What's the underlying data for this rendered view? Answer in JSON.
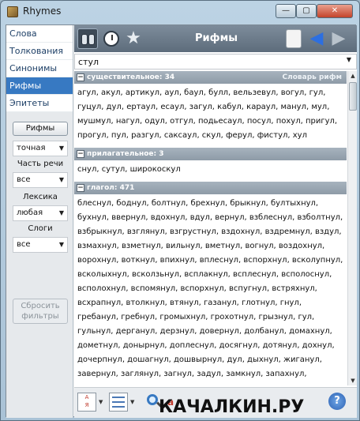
{
  "window": {
    "title": "Rhymes",
    "controls": {
      "minimize": "—",
      "maximize": "▢",
      "close": "✕"
    }
  },
  "nav": [
    {
      "label": "Слова",
      "active": false
    },
    {
      "label": "Толкования",
      "active": false
    },
    {
      "label": "Синонимы",
      "active": false
    },
    {
      "label": "Рифмы",
      "active": true
    },
    {
      "label": "Эпитеты",
      "active": false
    }
  ],
  "filters": {
    "rhymes_button": "Рифмы",
    "match_value": "точная",
    "part_of_speech_label": "Часть речи",
    "part_of_speech_value": "все",
    "lexicon_label": "Лексика",
    "lexicon_value": "любая",
    "syllables_label": "Слоги",
    "syllables_value": "все",
    "reset_button": "Сбросить фильтры"
  },
  "toolbar": {
    "title": "Рифмы"
  },
  "search": {
    "value": "стул"
  },
  "sections": [
    {
      "header": "существительное: 34",
      "dictionary_link": "Словарь рифм",
      "words": "агул, акул, артикул, аул, баул, булл, вельзевул, вогул, гул, гуцул, дул, ертаул, есаул, загул, кабул, караул, манул, мул, мушмул, нагул, одул, отгул, подьесаул, посул, похул, пригул, прогул, пул, разгул, саксаул, скул, ферул, фистул, хул"
    },
    {
      "header": "прилагательное: 3",
      "words": "снул, сутул, широкоскул"
    },
    {
      "header": "глагол: 471",
      "words": "блеснул, боднул, болтнул, брехнул, брыкнул, бултыхнул, бухнул, ввернул, вдохнул, вдул, вернул, взблеснул, взболтнул, взбрыкнул, взглянул, взгрустнул, вздохнул, вздремнул, вздул, взмахнул, взметнул, вильнул, вметнул, вогнул, воздохнул, ворохнул, воткнул, впихнул, вплеснул, вспорхнул, всколупнул, всколыхнул, всколзьнул, всплакнул, всплеснул, всполоснул, всполохнул, вспомянул, вспорхнул, вспугнул, встряхнул, всхрапнул, втолкнул, втянул, газанул, глотнул, гнул, гребанул, гребнул, громыхнул, грохотнул, грызнул, гул, гульнул, дерганул, дерзнул, довернул, долбанул, домахнул, дометнул, донырнул, доплеснул, досягнул, дотянул, дохнул, дочерпнул, дошагнул, дошвырнул, дул, дыхнул, жиганул, завернул, заглянул, загнул, задул, замкнул, запахнул, запихнул, заплеснул, заполоснул, запорхнул, заснул, застегнул, заткнул, затолкнул, затонул, затянул, захлебнул, захлестнул, захолонул, зачеркнул"
    }
  ],
  "bottombar": {
    "font_icon": "а",
    "help": "?"
  },
  "watermark": "КАЧАЛКИН.РУ"
}
